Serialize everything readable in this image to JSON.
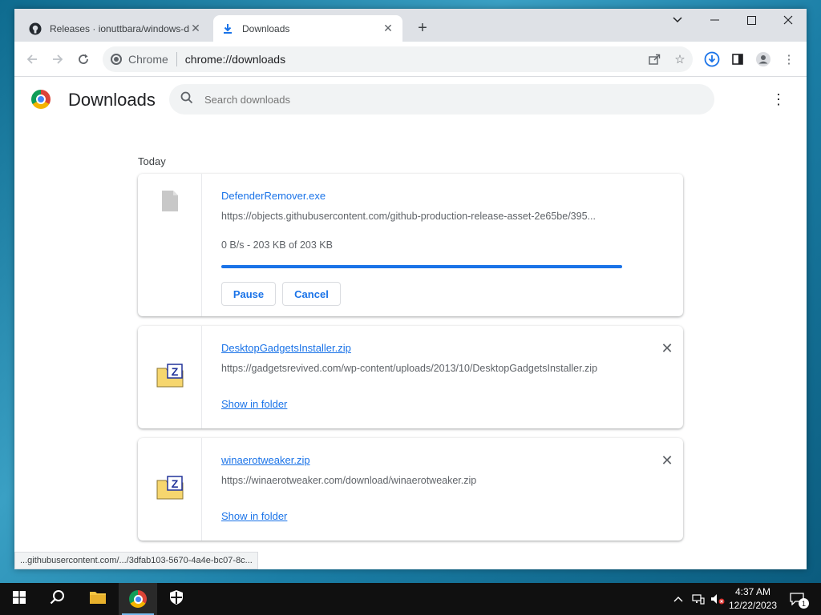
{
  "tabs": [
    {
      "title": "Releases · ionuttbara/windows-d",
      "icon": "github-icon"
    },
    {
      "title": "Downloads",
      "icon": "download-icon"
    }
  ],
  "omnibox": {
    "chip": "Chrome",
    "url": "chrome://downloads"
  },
  "page": {
    "title": "Downloads",
    "search_placeholder": "Search downloads",
    "date_label": "Today"
  },
  "downloads": [
    {
      "filename": "DefenderRemover.exe",
      "url": "https://objects.githubusercontent.com/github-production-release-asset-2e65be/395...",
      "status": "0 B/s - 203 KB of 203 KB",
      "progress": 1.0,
      "pause_label": "Pause",
      "cancel_label": "Cancel",
      "icon": "file-icon"
    },
    {
      "filename": "DesktopGadgetsInstaller.zip",
      "url": "https://gadgetsrevived.com/wp-content/uploads/2013/10/DesktopGadgetsInstaller.zip",
      "action_label": "Show in folder",
      "icon": "zip-folder-icon"
    },
    {
      "filename": "winaerotweaker.zip",
      "url": "https://winaerotweaker.com/download/winaerotweaker.zip",
      "action_label": "Show in folder",
      "icon": "zip-folder-icon"
    }
  ],
  "status_bar": "...githubusercontent.com/.../3dfab103-5670-4a4e-bc07-8c...",
  "taskbar": {
    "time": "4:37 AM",
    "date": "12/22/2023",
    "notification_count": "1"
  },
  "colors": {
    "accent": "#1a73e8",
    "taskbar": "#101010"
  }
}
